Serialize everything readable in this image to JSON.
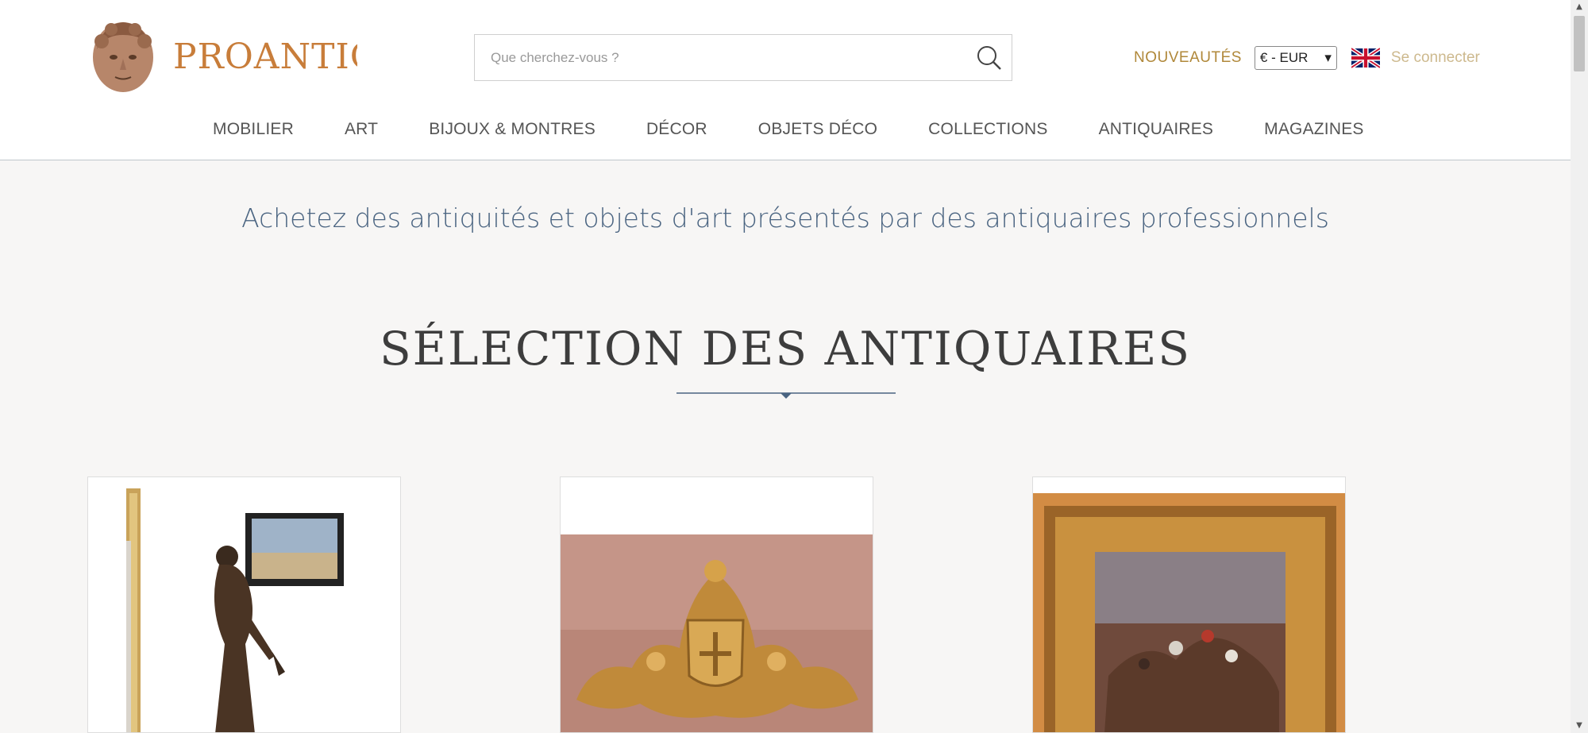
{
  "header": {
    "logo_text": "PROANTIC",
    "search_placeholder": "Que cherchez-vous ?",
    "new_label": "NOUVEAUTÉS",
    "currency_value": "€ - EUR",
    "currency_caret": "▾",
    "login_label": "Se connecter"
  },
  "nav": {
    "items": [
      {
        "label": "MOBILIER"
      },
      {
        "label": "ART"
      },
      {
        "label": "BIJOUX & MONTRES"
      },
      {
        "label": "DÉCOR"
      },
      {
        "label": "OBJETS DÉCO"
      },
      {
        "label": "COLLECTIONS"
      },
      {
        "label": "ANTIQUAIRES"
      },
      {
        "label": "MAGAZINES"
      }
    ]
  },
  "main": {
    "tagline": "Achetez des antiquités et objets d'art présentés par des antiquaires professionnels",
    "section_title": "SÉLECTION DES ANTIQUAIRES"
  },
  "colors": {
    "brand": "#c87d3a",
    "nav_text": "#555555",
    "tagline": "#4a6481",
    "gold": "#b0883a"
  },
  "icons": {
    "search": "magnifier",
    "flag": "uk-flag"
  }
}
